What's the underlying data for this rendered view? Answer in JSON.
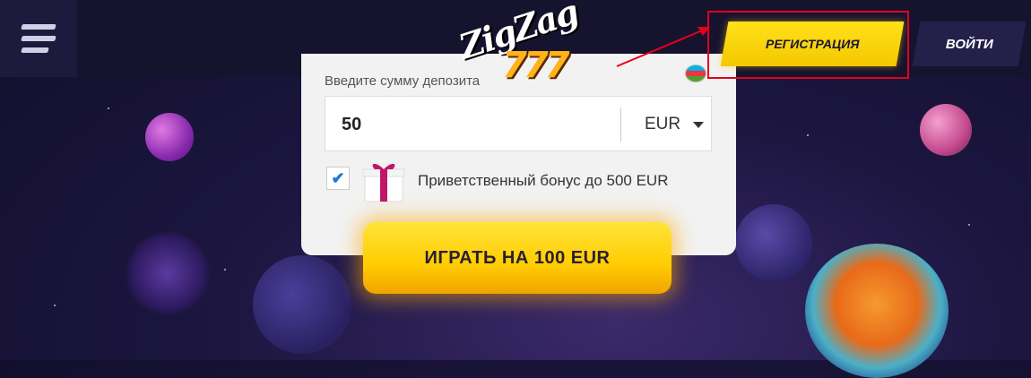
{
  "header": {
    "logo_text": "ZigZag",
    "logo_number": "777",
    "register_label": "РЕГИСТРАЦИЯ",
    "login_label": "ВОЙТИ"
  },
  "deposit": {
    "label": "Введите сумму депозита",
    "amount": "50",
    "currency": "EUR"
  },
  "bonus": {
    "checked": true,
    "text": "Приветственный бонус до 500 EUR"
  },
  "play_button": "ИГРАТЬ НА 100 EUR",
  "colors": {
    "accent_yellow": "#ffd400",
    "highlight_red": "#e4001b",
    "header_bg": "#16132f"
  },
  "icons": [
    "menu-icon",
    "flag-icon",
    "chevron-down-icon",
    "checkmark-icon",
    "gift-icon"
  ]
}
